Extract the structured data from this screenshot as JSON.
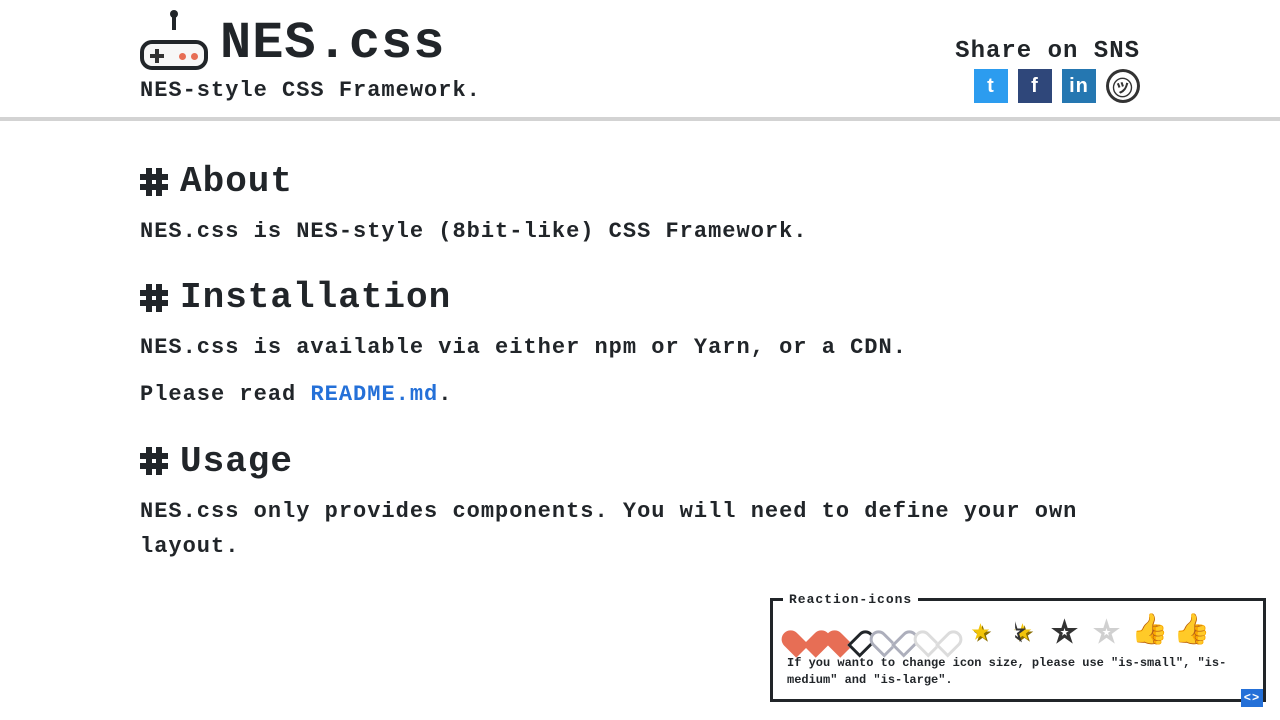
{
  "header": {
    "title": "NES.css",
    "subtitle": "NES-style CSS Framework."
  },
  "sns": {
    "label": "Share on SNS"
  },
  "sections": {
    "about": {
      "heading": "About",
      "body": "NES.css is NES-style (8bit-like) CSS Framework."
    },
    "install": {
      "heading": "Installation",
      "body1": "NES.css is available via either npm or Yarn, or a CDN.",
      "body2_pre": "Please read ",
      "body2_link": "README.md",
      "body2_post": "."
    },
    "usage": {
      "heading": "Usage",
      "body": "NES.css only provides components. You will need to define your own layout."
    }
  },
  "panel": {
    "legend": "Reaction-icons",
    "note": "If you wanto to change icon size, please use \"is-small\", \"is-medium\" and \"is-large\"."
  }
}
